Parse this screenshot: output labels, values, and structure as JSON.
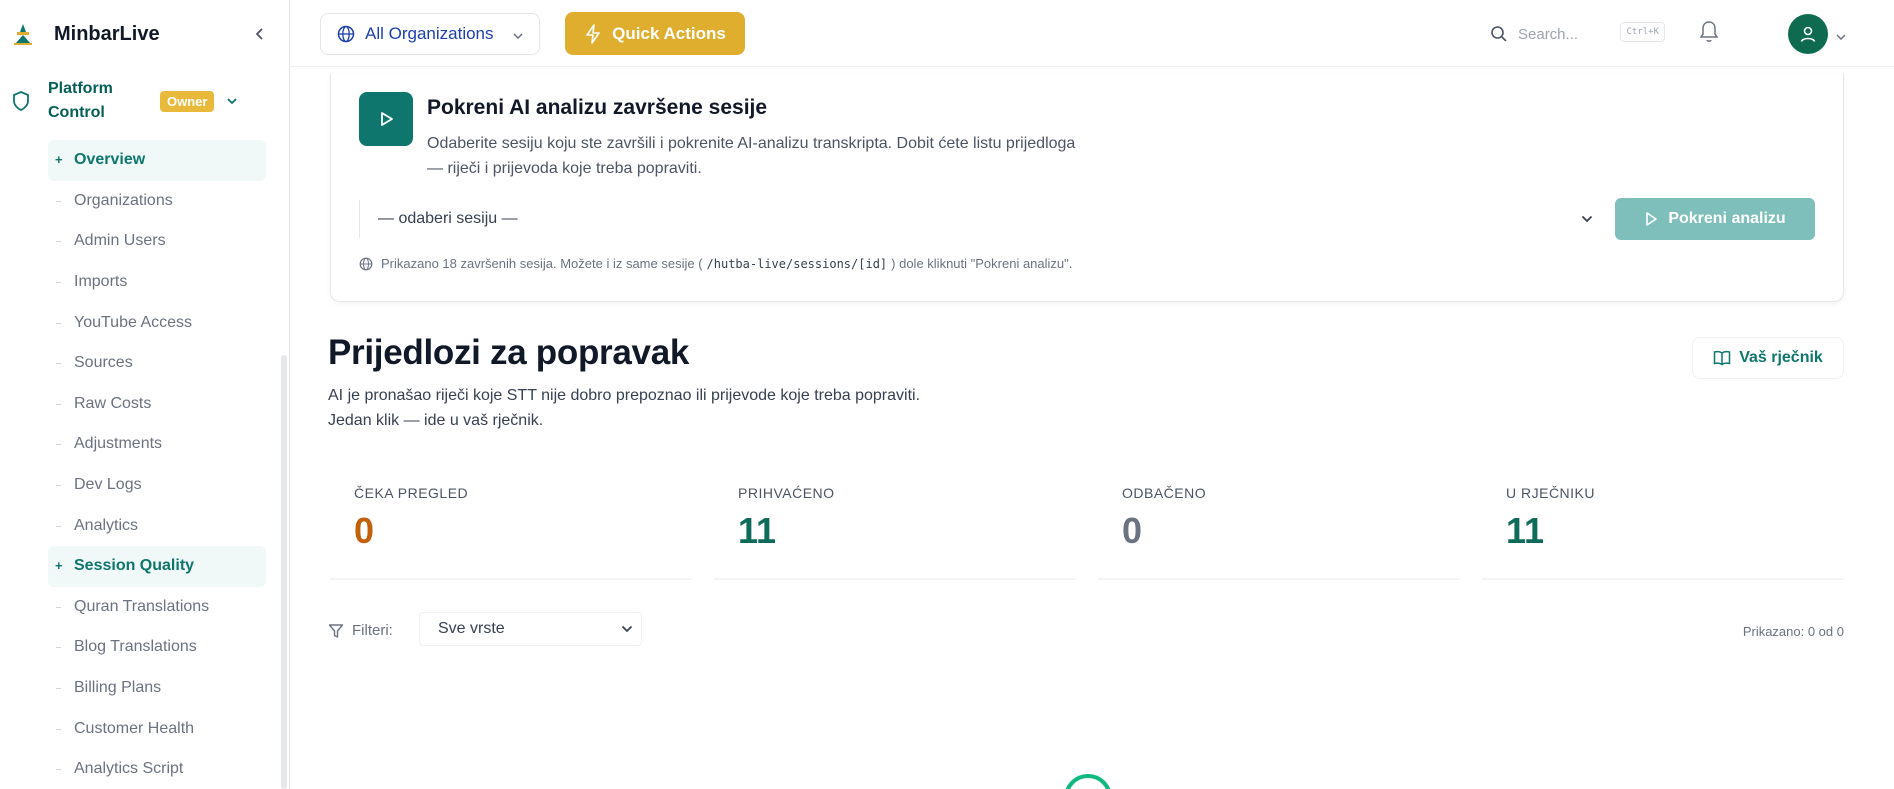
{
  "sidebar": {
    "brand": "MinbarLive",
    "platform_label": "Platform Control",
    "owner_badge": "Owner",
    "items": [
      {
        "label": "Overview",
        "active": true
      },
      {
        "label": "Organizations",
        "active": false
      },
      {
        "label": "Admin Users",
        "active": false
      },
      {
        "label": "Imports",
        "active": false
      },
      {
        "label": "YouTube Access",
        "active": false
      },
      {
        "label": "Sources",
        "active": false
      },
      {
        "label": "Raw Costs",
        "active": false
      },
      {
        "label": "Adjustments",
        "active": false
      },
      {
        "label": "Dev Logs",
        "active": false
      },
      {
        "label": "Analytics",
        "active": false
      },
      {
        "label": "Session Quality",
        "active": true
      },
      {
        "label": "Quran Translations",
        "active": false
      },
      {
        "label": "Blog Translations",
        "active": false
      },
      {
        "label": "Billing Plans",
        "active": false
      },
      {
        "label": "Customer Health",
        "active": false
      },
      {
        "label": "Analytics Script",
        "active": false
      }
    ]
  },
  "topbar": {
    "org_select": "All Organizations",
    "quick_actions": "Quick Actions",
    "search_placeholder": "Search...",
    "search_shortcut": "Ctrl+K"
  },
  "analysis_card": {
    "title": "Pokreni AI analizu završene sesije",
    "description": "Odaberite sesiju koju ste završili i pokrenite AI-analizu transkripta. Dobit ćete listu prijedloga — riječi i prijevoda koje treba popraviti.",
    "select_value": "— odaberi sesiju —",
    "run_button": "Pokreni analizu",
    "note_before": "Prikazano 18 završenih sesija. Možete i iz same sesije (",
    "note_code": "/hutba-live/sessions/[id]",
    "note_after": ") dole kliknuti \"Pokreni analizu\"."
  },
  "suggestions": {
    "title": "Prijedlozi za popravak",
    "description_line1": "AI je pronašao riječi koje STT nije dobro prepoznao ili prijevode koje treba popraviti.",
    "description_line2": "Jedan klik — ide u vaš rječnik.",
    "dictionary_button": "Vaš rječnik"
  },
  "stats": [
    {
      "label": "ČEKA PREGLED",
      "value": "0",
      "color": "#c2610c"
    },
    {
      "label": "PRIHVAĆENO",
      "value": "11",
      "color": "#0f6b5a"
    },
    {
      "label": "ODBAČENO",
      "value": "0",
      "color": "#6b7280"
    },
    {
      "label": "U RJEČNIKU",
      "value": "11",
      "color": "#0f6b5a"
    }
  ],
  "filters": {
    "label": "Filteri:",
    "select_value": "Sve vrste",
    "shown_count": "Prikazano: 0 od 0"
  },
  "colors": {
    "accent": "#0f766e",
    "quick_actions": "#e0ae2e",
    "owner_badge": "#e8b93a"
  }
}
